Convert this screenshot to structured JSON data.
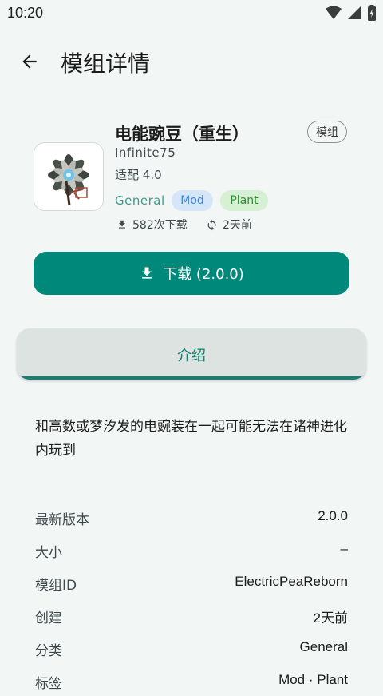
{
  "status_bar": {
    "time": "10:20"
  },
  "header": {
    "title": "模组详情"
  },
  "mod": {
    "title": "电能豌豆（重生）",
    "type_chip": "模组",
    "author": "Infinite75",
    "compat_label": "适配",
    "compat_version": "4.0",
    "category": "General",
    "tags": [
      "Mod",
      "Plant"
    ],
    "downloads": "582次下载",
    "updated": "2天前",
    "colors": {
      "accent": "#00897b",
      "mod_tag": "#3f83d7",
      "plant_tag": "#2f8a35"
    }
  },
  "download_button": {
    "label": "下载 (2.0.0)"
  },
  "tab": {
    "label": "介绍"
  },
  "description": "和高数或梦汐发的电豌装在一起可能无法在诸神进化内玩到",
  "info": [
    {
      "key": "最新版本",
      "value": "2.0.0"
    },
    {
      "key": "大小",
      "value": "–"
    },
    {
      "key": "模组ID",
      "value": "ElectricPeaReborn"
    },
    {
      "key": "创建",
      "value": "2天前"
    },
    {
      "key": "分类",
      "value": "General"
    },
    {
      "key": "标签",
      "value": "Mod · Plant"
    }
  ]
}
